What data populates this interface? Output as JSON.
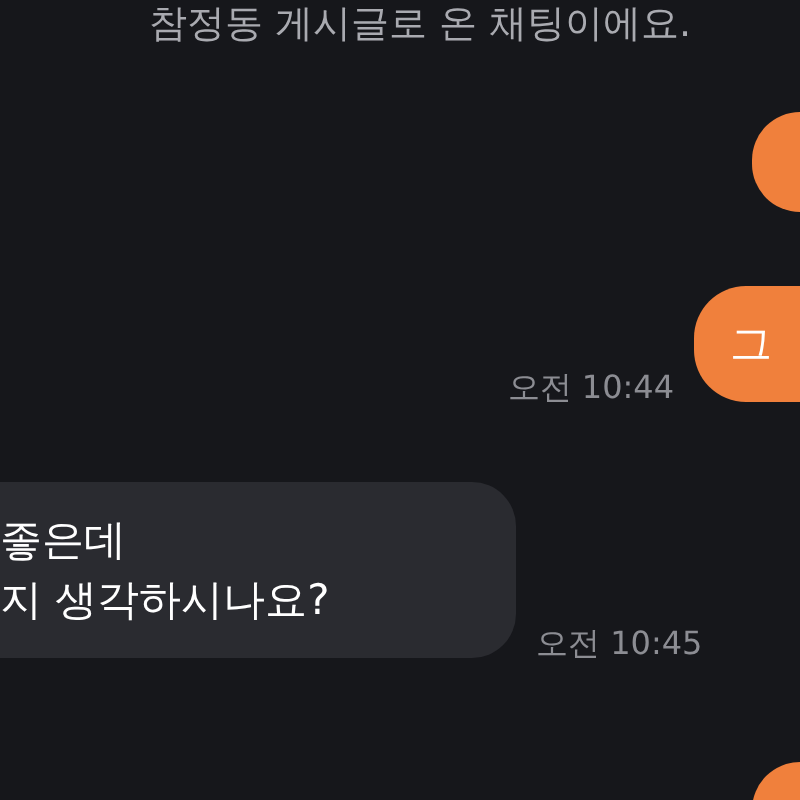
{
  "notice": "참정동 게시글로 온 채팅이에요.",
  "messages": [
    {
      "kind": "sent"
    },
    {
      "kind": "sent",
      "lines": [
        "그"
      ],
      "time": "오전 10:44"
    },
    {
      "kind": "received",
      "lines": [
        "좋은데",
        "지 생각하시나요?"
      ],
      "time": "오전 10:45"
    },
    {
      "kind": "sent"
    }
  ]
}
